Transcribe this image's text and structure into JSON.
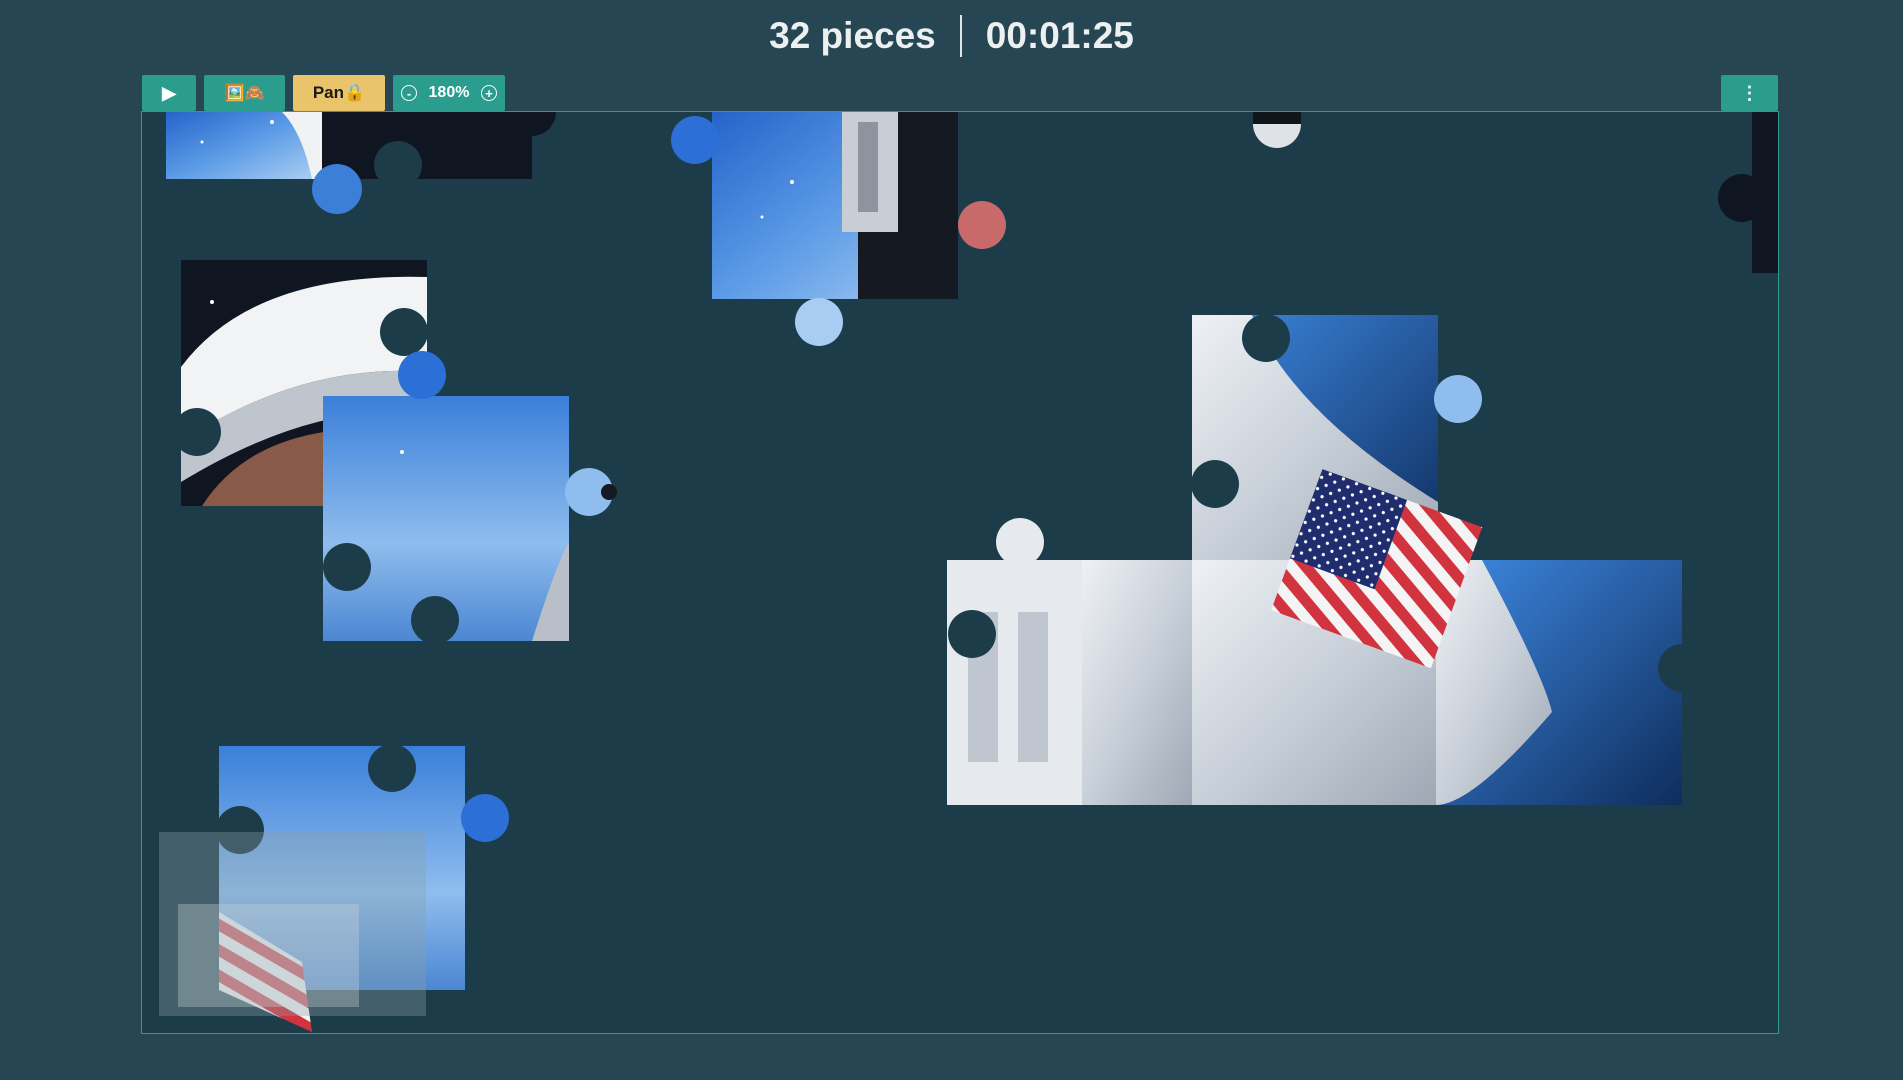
{
  "header": {
    "pieces_label": "32 pieces",
    "timer": "00:01:25"
  },
  "toolbar": {
    "play_icon": "play-icon",
    "play_glyph": "▶",
    "preview_label": "🖼️🙈",
    "pan_label": "Pan🔒",
    "zoom_out_glyph": "-",
    "zoom_level": "180%",
    "zoom_in_glyph": "+",
    "menu_glyph": "⋮"
  },
  "colors": {
    "background": "#264653",
    "board": "#1d3c4a",
    "accent": "#2a9d8f",
    "pan_button": "#e9c46a"
  }
}
